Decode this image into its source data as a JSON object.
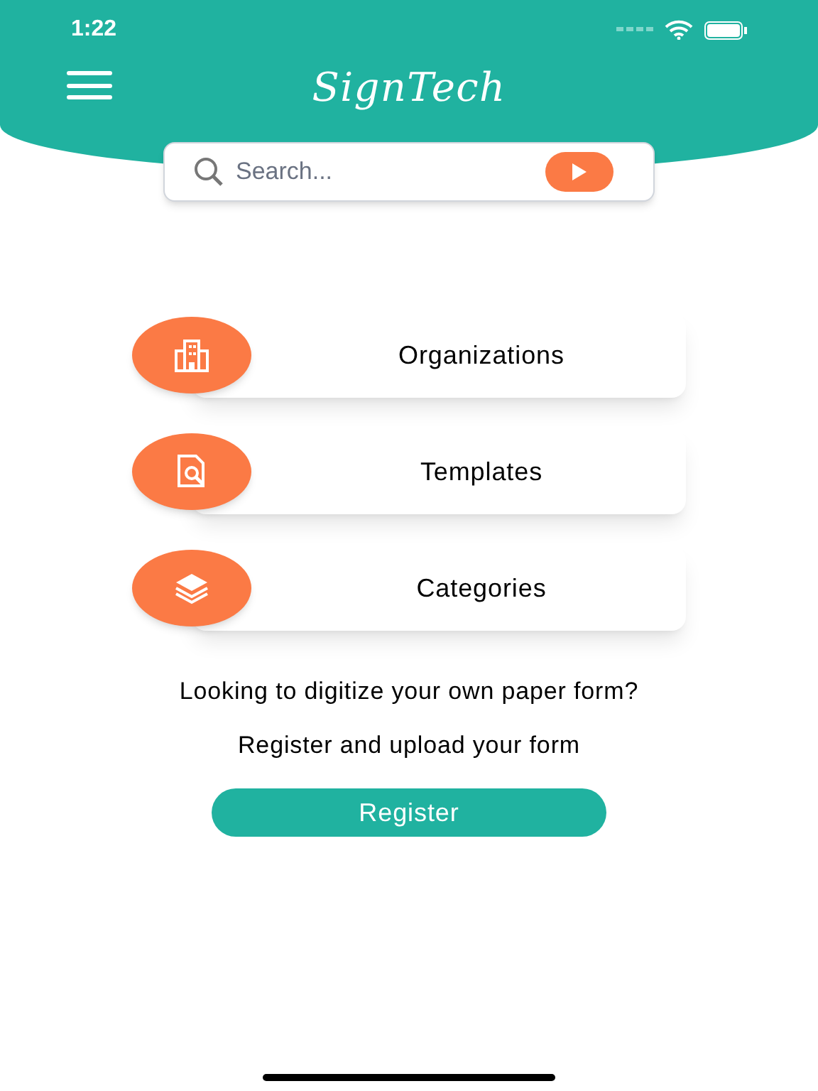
{
  "status_bar": {
    "time": "1:22"
  },
  "header": {
    "logo": "SignTech"
  },
  "search": {
    "placeholder": "Search..."
  },
  "menu_items": [
    {
      "kind": "building",
      "label": "Organizations"
    },
    {
      "kind": "document",
      "label": "Templates"
    },
    {
      "kind": "layers",
      "label": "Categories"
    }
  ],
  "prompt": "Looking to digitize your own paper form?",
  "subprompt": "Register and upload your form",
  "register_button": "Register"
}
